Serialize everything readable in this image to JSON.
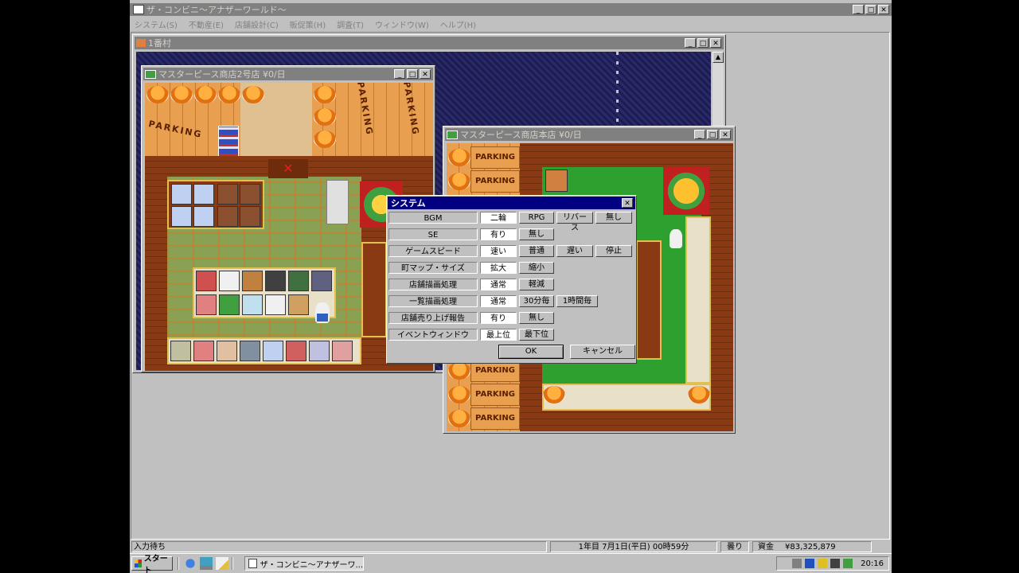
{
  "app": {
    "title": "ザ・コンビニ～アナザーワールド～",
    "menu": [
      "システム(S)",
      "不動産(E)",
      "店舗設計(C)",
      "販促策(H)",
      "調査(T)",
      "ウィンドウ(W)",
      "ヘルプ(H)"
    ]
  },
  "windows": {
    "town": {
      "title": "1番村"
    },
    "store2": {
      "title": "マスターピース商店2号店 ¥0/日"
    },
    "store_main": {
      "title": "マスターピース商店本店 ¥0/日"
    }
  },
  "parking_text": "PARKING",
  "dialog": {
    "title": "システム",
    "rows": [
      {
        "label": "BGM",
        "value": "二輪",
        "options": [
          "RPG",
          "リバース",
          "無し"
        ]
      },
      {
        "label": "SE",
        "value": "有り",
        "options": [
          "無し"
        ]
      },
      {
        "label": "ゲームスピード",
        "value": "速い",
        "options": [
          "普通",
          "遅い",
          "停止"
        ]
      },
      {
        "label": "町マップ・サイズ",
        "value": "拡大",
        "options": [
          "縮小"
        ]
      },
      {
        "label": "店舗描画処理",
        "value": "通常",
        "options": [
          "軽減"
        ]
      },
      {
        "label": "一覧描画処理",
        "value": "通常",
        "options": [
          "30分毎",
          "1時間毎"
        ]
      },
      {
        "label": "店舗売り上げ報告",
        "value": "有り",
        "options": [
          "無し"
        ]
      },
      {
        "label": "イベントウィンドウ",
        "value": "最上位",
        "options": [
          "最下位"
        ]
      }
    ],
    "ok_label": "OK",
    "cancel_label": "キャンセル"
  },
  "status": {
    "left": "入力待ち",
    "date": "1年目 7月1日(平日) 00時59分",
    "weather": "曇り",
    "funds_label": "資金",
    "funds": "¥83,325,879"
  },
  "taskbar": {
    "start_label": "スタート",
    "task_label": "ザ・コンビニ～アナザーワ...",
    "clock": "20:16"
  }
}
